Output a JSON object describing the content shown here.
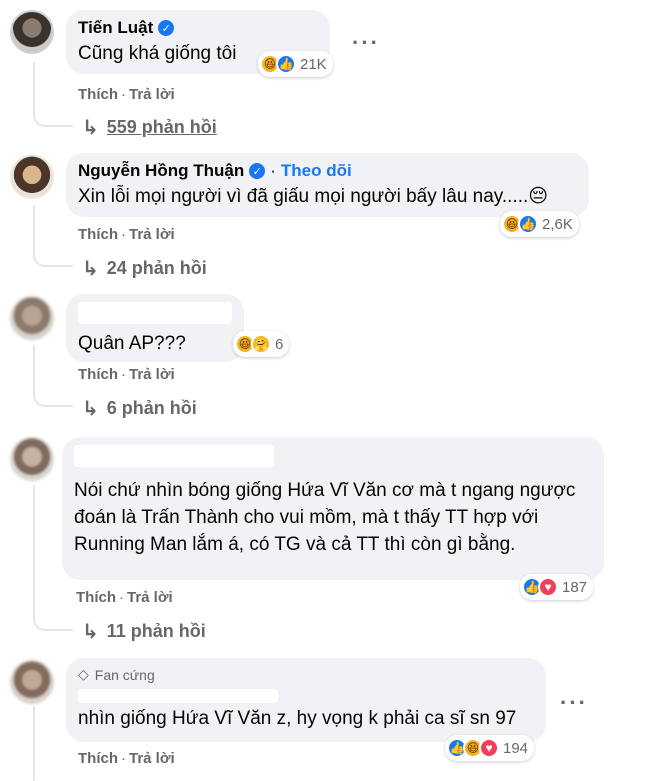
{
  "comments": [
    {
      "author": "Tiến Luật",
      "verified": true,
      "text": "Cũng khá giống tôi",
      "reaction_count": "21K",
      "reactions": [
        "haha",
        "like"
      ],
      "actions": {
        "like": "Thích",
        "reply": "Trả lời"
      },
      "replies": "559 phản hồi"
    },
    {
      "author": "Nguyễn Hồng Thuận",
      "verified": true,
      "follow": "Theo dõi",
      "text": "Xin lỗi mọi người vì đã giấu mọi người bấy lâu nay.....😔",
      "reaction_count": "2,6K",
      "reactions": [
        "haha",
        "like"
      ],
      "actions": {
        "like": "Thích",
        "reply": "Trả lời"
      },
      "replies": "24 phản hồi"
    },
    {
      "text": "Quân AP???",
      "reaction_count": "6",
      "reactions": [
        "haha",
        "care"
      ],
      "actions": {
        "like": "Thích",
        "reply": "Trả lời"
      },
      "replies": "6 phản hồi"
    },
    {
      "text": "Nói chứ nhìn bóng giống Hứa Vĩ Văn cơ mà t ngang ngược đoán là Trấn Thành cho vui mồm, mà t thấy TT hợp với Running Man lắm á, có TG và cả TT thì còn gì bằng.",
      "reaction_count": "187",
      "reactions": [
        "like",
        "love"
      ],
      "actions": {
        "like": "Thích",
        "reply": "Trả lời"
      },
      "replies": "11 phản hồi"
    },
    {
      "badge": "Fan cứng",
      "text": "nhìn giống Hứa Vĩ Văn z, hy vọng k phải ca sĩ sn 97",
      "reaction_count": "194",
      "reactions": [
        "like",
        "haha",
        "love"
      ],
      "actions": {
        "like": "Thích",
        "reply": "Trả lời"
      }
    }
  ],
  "icons": {
    "reply_arrow": "↳",
    "more": "···",
    "verified": "✓",
    "diamond": "◇"
  }
}
